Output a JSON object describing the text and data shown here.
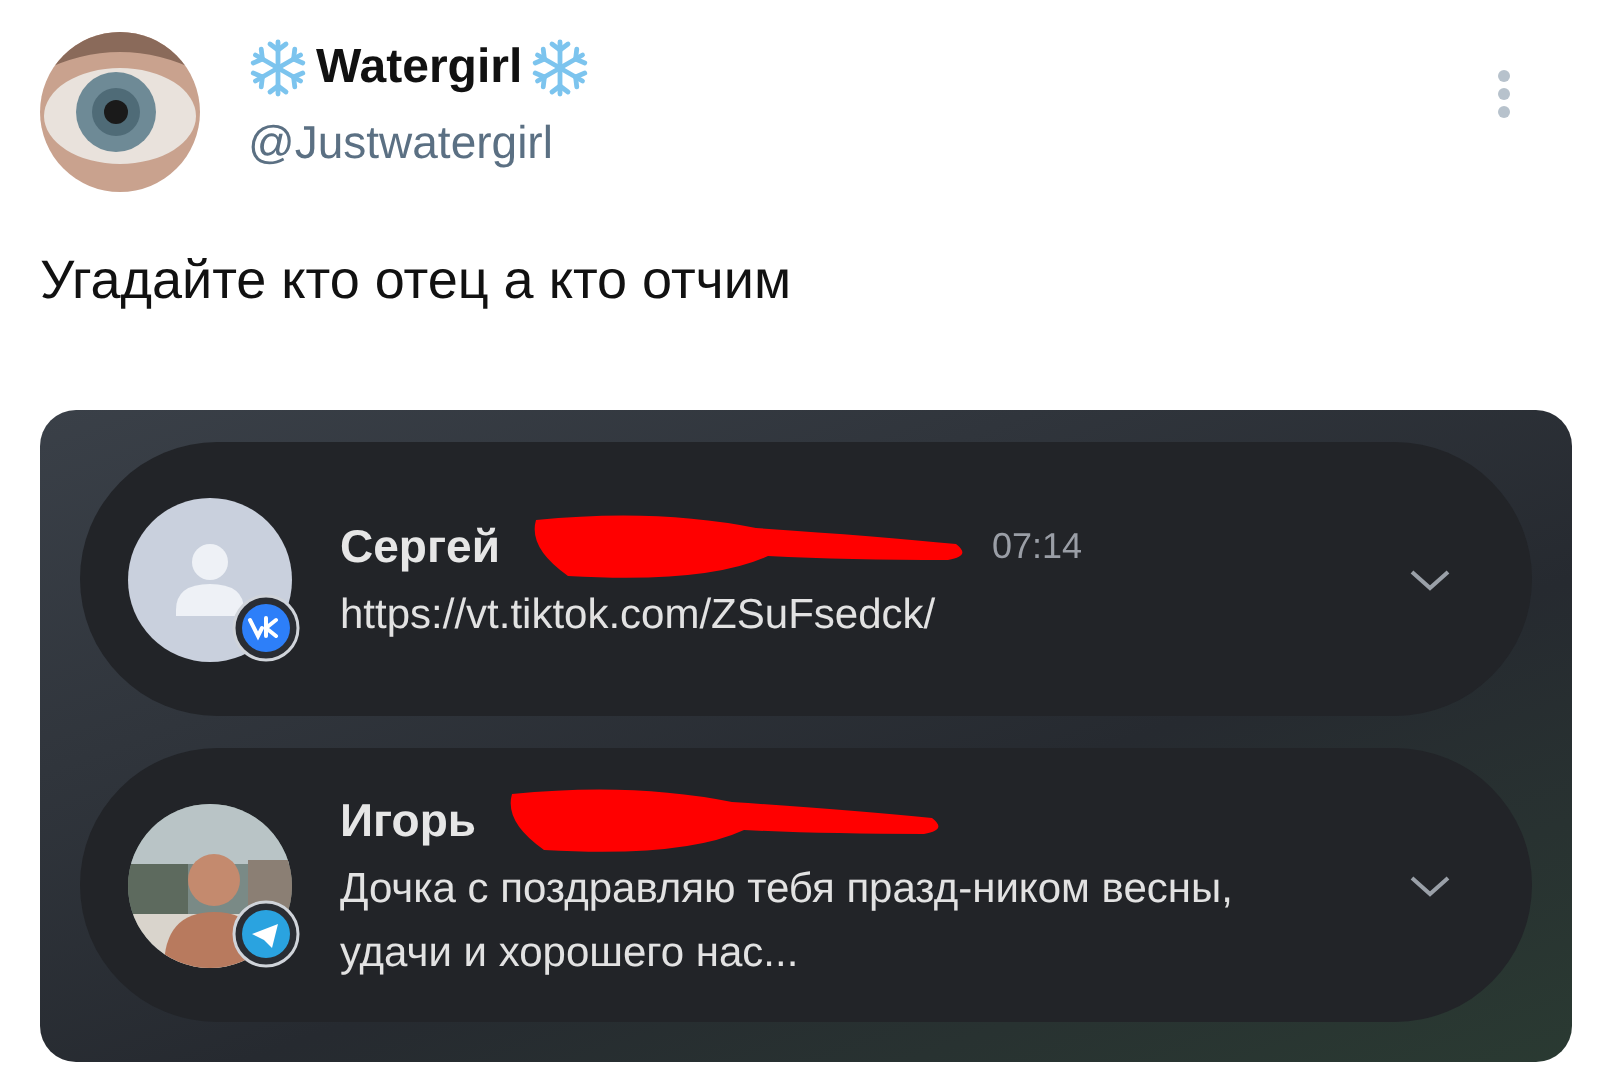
{
  "author": {
    "name": "Watergirl",
    "handle": "@Justwatergirl"
  },
  "tweet": {
    "text": "Угадайте кто отец а кто отчим"
  },
  "notifications": [
    {
      "sender": "Сергей",
      "time": "07:14",
      "badge": {
        "kind": "vk"
      },
      "message": "https://vt.tiktok.com/ZSuFsedck/",
      "avatar": {
        "kind": "icon"
      }
    },
    {
      "sender": "Игорь",
      "badge": {
        "kind": "telegram"
      },
      "message": "Дочка с поздравляю тебя празд-ником весны, удачи и хорошего нас..."
    }
  ]
}
